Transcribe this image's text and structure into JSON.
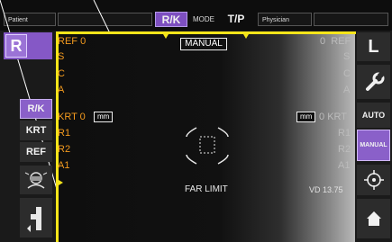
{
  "header": {
    "patient_label": "Patient",
    "mode_left": "R/K",
    "mode_label": "MODE",
    "mode_right": "T/P",
    "physician_label": "Physician"
  },
  "left_sidebar": {
    "eye": "R",
    "buttons": [
      "R/K",
      "KRT",
      "REF"
    ]
  },
  "right_sidebar": {
    "eye": "L",
    "auto_label": "AUTO",
    "manual_label": "MANUAL"
  },
  "view": {
    "manual_badge": "MANUAL",
    "left_top": {
      "ref_label": "REF",
      "ref_value": "0",
      "s": "S",
      "c": "C",
      "a": "A"
    },
    "right_top": {
      "ref_value": "0",
      "ref_label": "REF",
      "s": "S",
      "c": "C",
      "a": "A"
    },
    "left_krt": {
      "label": "KRT",
      "value": "0",
      "unit": "mm",
      "r1": "R1",
      "r2": "R2",
      "a1": "A1"
    },
    "right_krt": {
      "unit": "mm",
      "value": "0",
      "label": "KRT",
      "r1": "R1",
      "r2": "R2",
      "a1": "A1"
    },
    "far_limit": "FAR LIMIT",
    "vd": "VD",
    "vd_value": "13.75"
  },
  "colors": {
    "accent_purple": "#8a60c9",
    "frame_yellow": "#f5e51a",
    "label_orange": "#f39a1e"
  },
  "icons": [
    "wrench-icon",
    "target-icon",
    "home-icon",
    "eye-face-icon",
    "chin-rest-icon"
  ]
}
